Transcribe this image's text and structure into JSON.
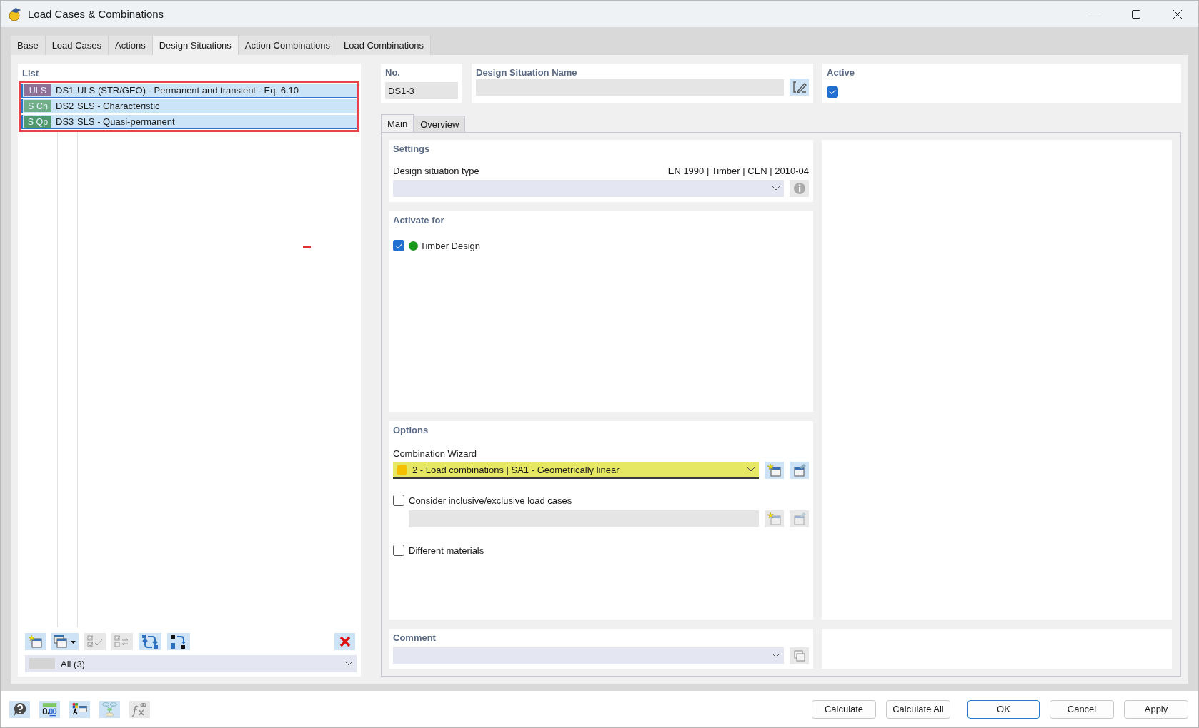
{
  "window": {
    "title": "Load Cases & Combinations"
  },
  "tabs": [
    {
      "label": "Base",
      "selected": false
    },
    {
      "label": "Load Cases",
      "selected": false
    },
    {
      "label": "Actions",
      "selected": false
    },
    {
      "label": "Design Situations",
      "selected": true
    },
    {
      "label": "Action Combinations",
      "selected": false
    },
    {
      "label": "Load Combinations",
      "selected": false
    }
  ],
  "list": {
    "title": "List",
    "rows": [
      {
        "badge": "ULS",
        "color": "#8e6f96",
        "no": "DS1",
        "name": "ULS (STR/GEO) - Permanent and transient - Eq. 6.10",
        "selected": true
      },
      {
        "badge": "S Ch",
        "color": "#6fae86",
        "no": "DS2",
        "name": "SLS - Characteristic",
        "selected": true
      },
      {
        "badge": "S Qp",
        "color": "#4f9a6c",
        "no": "DS3",
        "name": "SLS - Quasi-permanent",
        "selected": true
      }
    ],
    "toolbar": [
      {
        "kind": "new",
        "disabled": false
      },
      {
        "kind": "copy",
        "disabled": false
      },
      {
        "kind": "check",
        "disabled": true
      },
      {
        "kind": "toggle",
        "disabled": true
      },
      {
        "kind": "renumber",
        "disabled": false
      },
      {
        "kind": "sort",
        "disabled": false
      },
      {
        "kind": "delete",
        "disabled": false
      }
    ],
    "filter": {
      "value": "All (3)"
    }
  },
  "header": {
    "no": {
      "label": "No.",
      "value": "DS1-3"
    },
    "name": {
      "label": "Design Situation Name"
    },
    "active": {
      "label": "Active",
      "checked": true
    }
  },
  "inner_tabs": [
    {
      "label": "Main",
      "selected": true
    },
    {
      "label": "Overview",
      "selected": false
    }
  ],
  "settings": {
    "title": "Settings",
    "type_label": "Design situation type",
    "standard": "EN 1990 | Timber | CEN | 2010-04"
  },
  "activate_for": {
    "title": "Activate for",
    "items": [
      {
        "label": "Timber Design",
        "checked": true,
        "color": "#1a9a1a"
      }
    ]
  },
  "options": {
    "title": "Options",
    "wizard_label": "Combination Wizard",
    "wizard": {
      "value": "2 - Load combinations | SA1 - Geometrically linear",
      "color": "#f5c000"
    },
    "checks": [
      {
        "label": "Consider inclusive/exclusive load cases",
        "checked": false,
        "kind": "with-field"
      },
      {
        "label": "Different materials",
        "checked": false,
        "kind": "plain"
      }
    ]
  },
  "comment": {
    "title": "Comment"
  },
  "footer_tools": [
    {
      "kind": "help",
      "disabled": false
    },
    {
      "kind": "units",
      "disabled": false
    },
    {
      "kind": "colors",
      "disabled": false
    },
    {
      "kind": "tree",
      "disabled": false
    },
    {
      "kind": "formula",
      "disabled": true
    }
  ],
  "buttons": [
    {
      "label": "Calculate",
      "default": false
    },
    {
      "label": "Calculate All",
      "default": false
    },
    {
      "label": "OK",
      "default": true
    },
    {
      "label": "Cancel",
      "default": false
    },
    {
      "label": "Apply",
      "default": false
    }
  ]
}
